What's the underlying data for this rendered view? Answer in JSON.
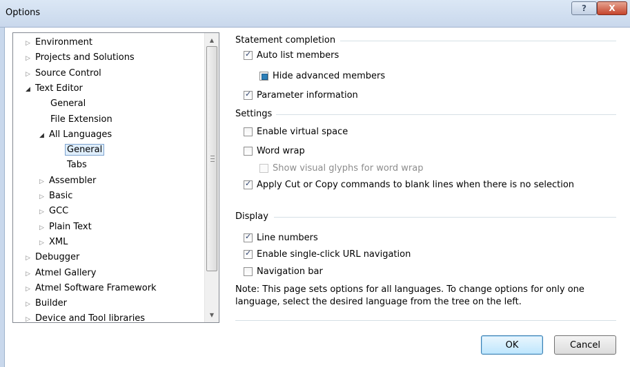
{
  "window": {
    "title": "Options",
    "help_glyph": "?",
    "close_glyph": "X"
  },
  "tree": {
    "items": [
      {
        "label": "Environment",
        "level": 0,
        "arrow": "collapsed"
      },
      {
        "label": "Projects and Solutions",
        "level": 0,
        "arrow": "collapsed"
      },
      {
        "label": "Source Control",
        "level": 0,
        "arrow": "collapsed"
      },
      {
        "label": "Text Editor",
        "level": 0,
        "arrow": "expanded"
      },
      {
        "label": "General",
        "level": 1,
        "arrow": "none"
      },
      {
        "label": "File Extension",
        "level": 1,
        "arrow": "none"
      },
      {
        "label": "All Languages",
        "level": 1,
        "arrow": "expanded"
      },
      {
        "label": "General",
        "level": 2,
        "arrow": "none",
        "selected": true
      },
      {
        "label": "Tabs",
        "level": 2,
        "arrow": "none"
      },
      {
        "label": "Assembler",
        "level": 1,
        "arrow": "collapsed"
      },
      {
        "label": "Basic",
        "level": 1,
        "arrow": "collapsed"
      },
      {
        "label": "GCC",
        "level": 1,
        "arrow": "collapsed"
      },
      {
        "label": "Plain Text",
        "level": 1,
        "arrow": "collapsed"
      },
      {
        "label": "XML",
        "level": 1,
        "arrow": "collapsed"
      },
      {
        "label": "Debugger",
        "level": 0,
        "arrow": "collapsed"
      },
      {
        "label": "Atmel Gallery",
        "level": 0,
        "arrow": "collapsed"
      },
      {
        "label": "Atmel Software Framework",
        "level": 0,
        "arrow": "collapsed"
      },
      {
        "label": "Builder",
        "level": 0,
        "arrow": "collapsed"
      },
      {
        "label": "Device and Tool libraries",
        "level": 0,
        "arrow": "collapsed"
      }
    ]
  },
  "statement_completion": {
    "header": "Statement completion",
    "auto_list_members": {
      "label": "Auto list members",
      "state": "checked"
    },
    "hide_advanced_members": {
      "label": "Hide advanced members",
      "state": "indeterminate"
    },
    "parameter_information": {
      "label": "Parameter information",
      "state": "checked"
    }
  },
  "settings": {
    "header": "Settings",
    "enable_virtual_space": {
      "label": "Enable virtual space",
      "state": "unchecked"
    },
    "word_wrap": {
      "label": "Word wrap",
      "state": "unchecked"
    },
    "show_visual_glyphs": {
      "label": "Show visual glyphs for word wrap",
      "state": "disabled"
    },
    "apply_cut_copy": {
      "label": "Apply Cut or Copy commands to blank lines when there is no selection",
      "state": "checked"
    }
  },
  "display": {
    "header": "Display",
    "line_numbers": {
      "label": "Line numbers",
      "state": "checked"
    },
    "url_navigation": {
      "label": "Enable single-click URL navigation",
      "state": "checked"
    },
    "navigation_bar": {
      "label": "Navigation bar",
      "state": "unchecked"
    },
    "note_line1": "Note: This page sets options for all languages. To change options for only one",
    "note_line2": "language, select the desired language from the tree on the left."
  },
  "buttons": {
    "ok": "OK",
    "cancel": "Cancel"
  },
  "colors": {
    "title_bar": "#c9d8ec",
    "selection_border": "#7da2ce",
    "close_red": "#c5452c"
  }
}
